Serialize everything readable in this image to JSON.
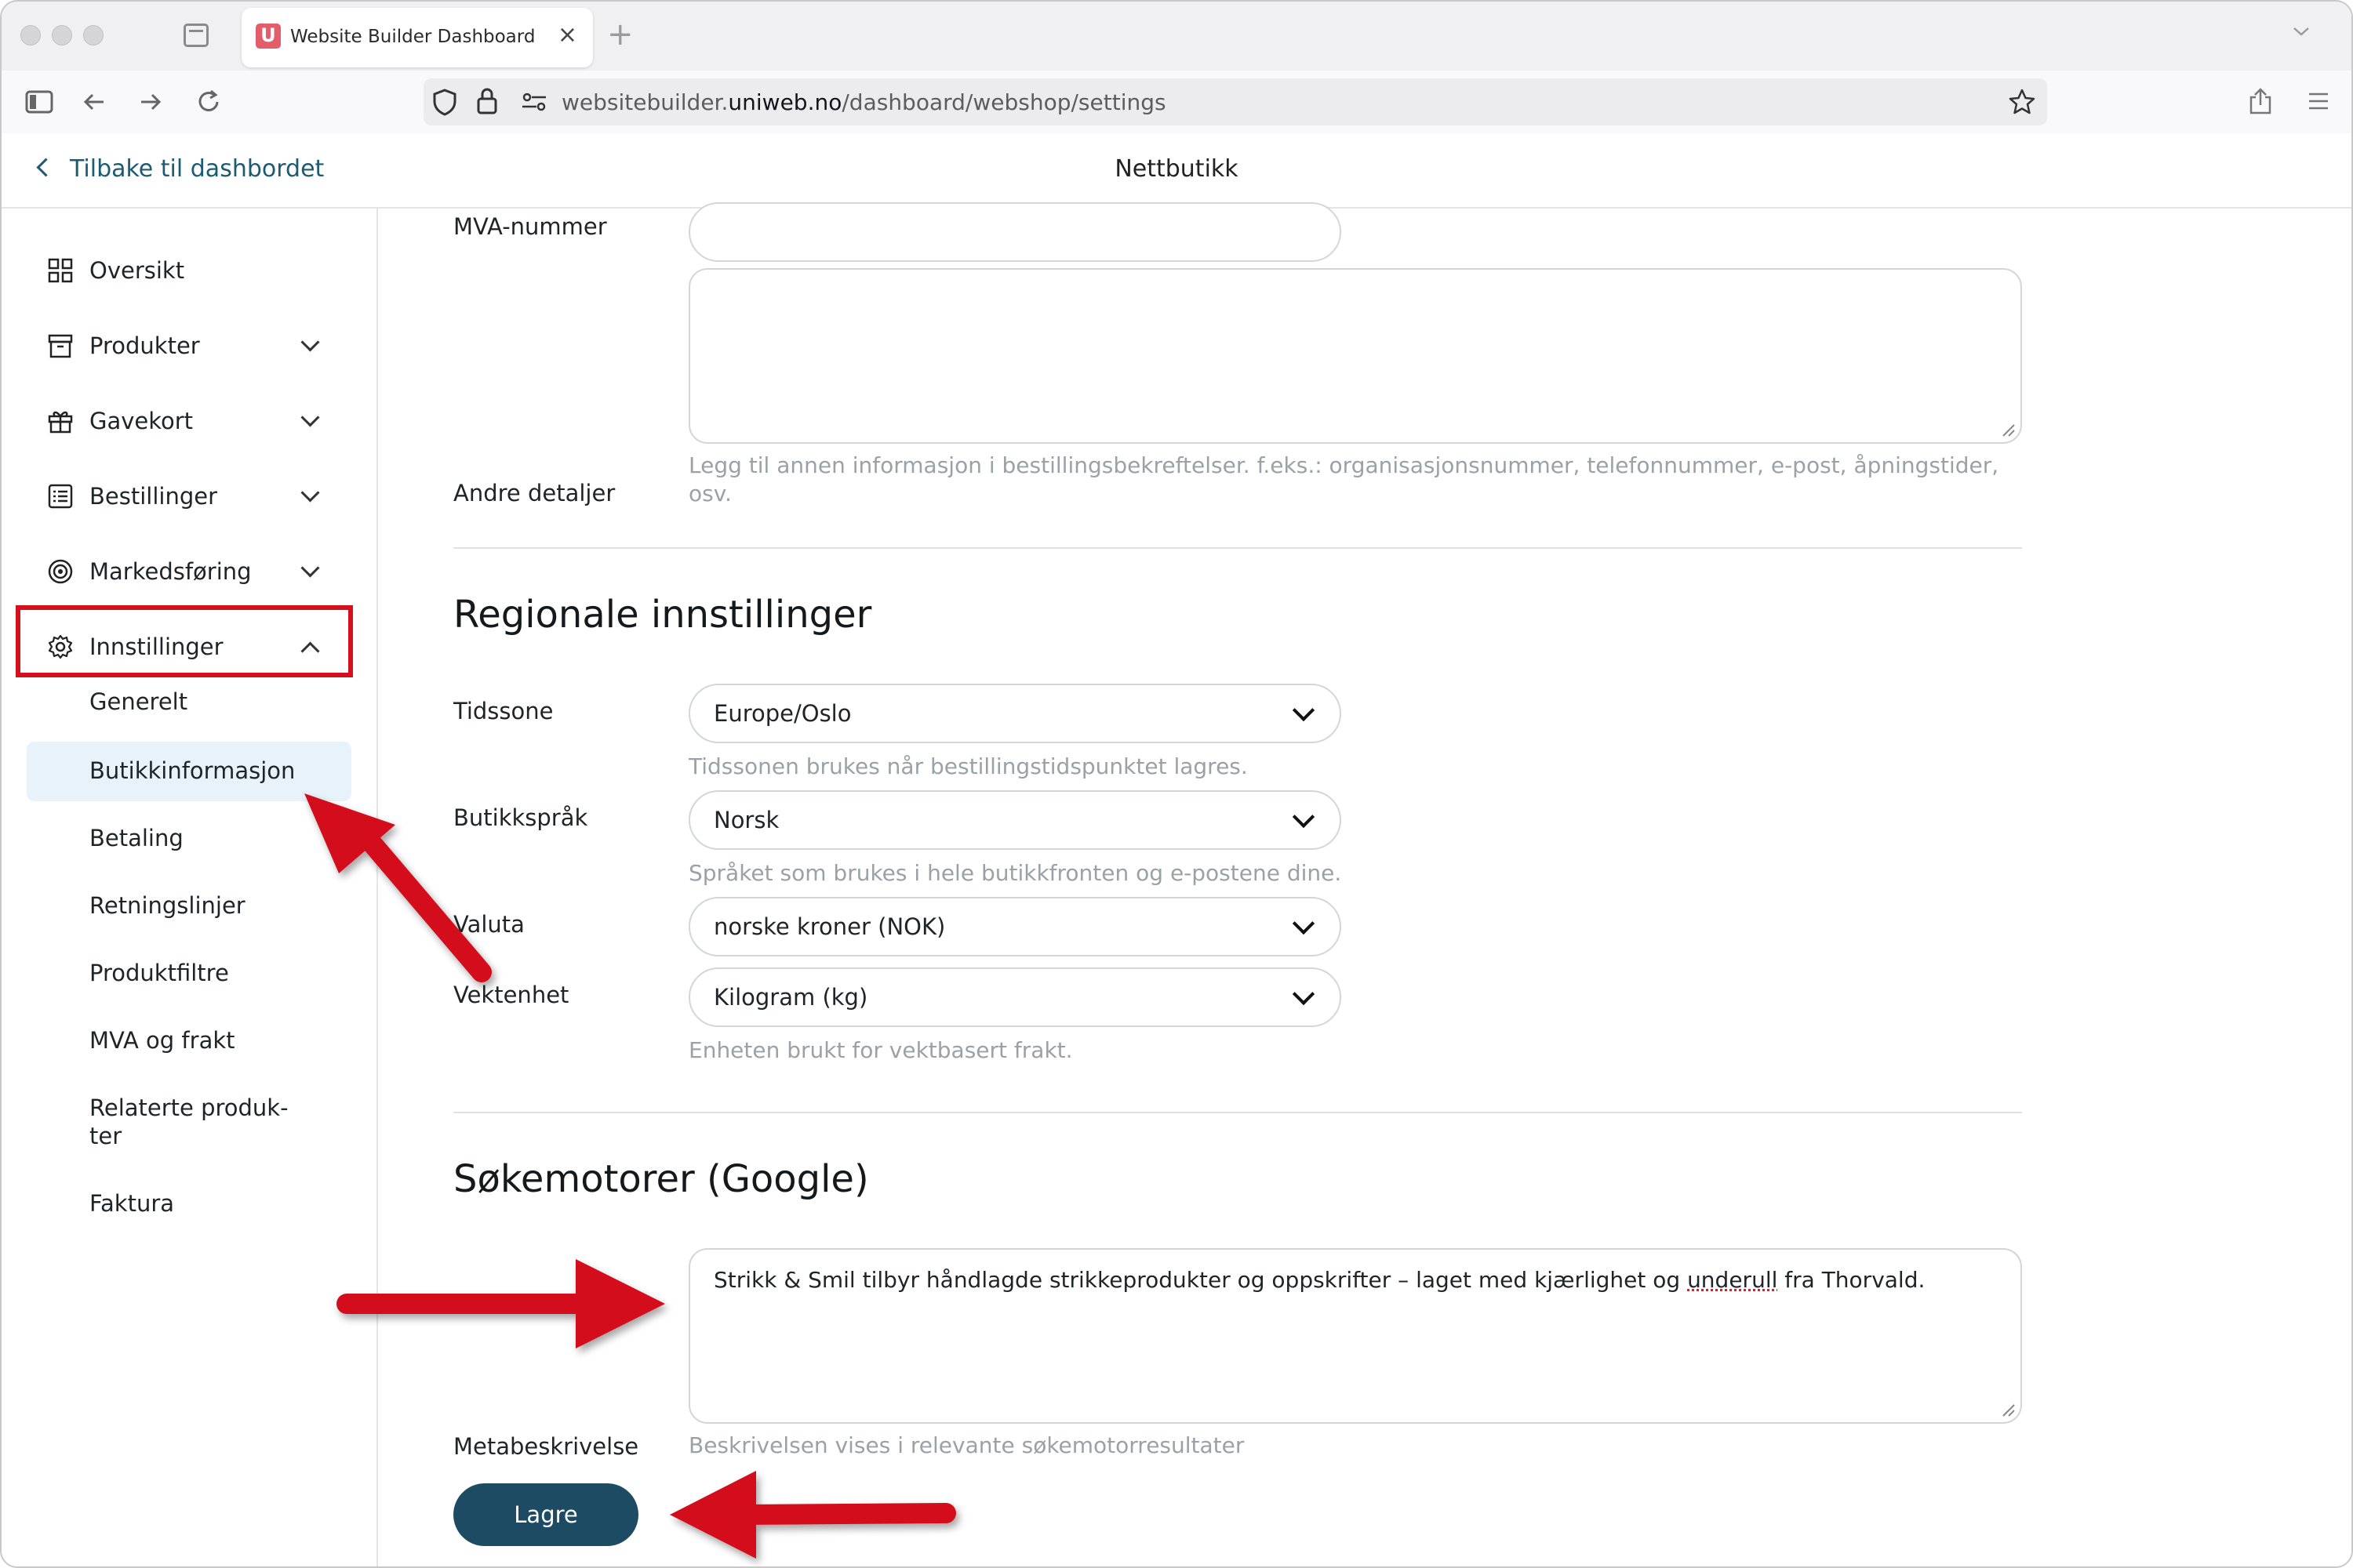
{
  "browser": {
    "tab_title": "Website Builder Dashboard",
    "tab_favicon": "U",
    "close_tab": "×",
    "new_tab": "+",
    "url_prefix": "websitebuilder.",
    "url_domain": "uniweb.no",
    "url_path": "/dashboard/webshop/settings"
  },
  "header": {
    "back_label": "Tilbake til dashbordet",
    "title": "Nettbutikk"
  },
  "sidebar": {
    "items": [
      {
        "label": "Oversikt",
        "icon": "grid-icon"
      },
      {
        "label": "Produkter",
        "icon": "archive-box-icon"
      },
      {
        "label": "Gavekort",
        "icon": "gift-icon"
      },
      {
        "label": "Bestillinger",
        "icon": "list-icon"
      },
      {
        "label": "Markedsføring",
        "icon": "target-icon"
      },
      {
        "label": "Innstillinger",
        "icon": "gear-icon"
      }
    ],
    "subitems": [
      "Generelt",
      "Butikkinformasjon",
      "Betaling",
      "Retningslinjer",
      "Produktfiltre",
      "MVA og frakt",
      "Relaterte produk-",
      "ter",
      "Faktura"
    ],
    "active_subitem": "Butikkinformasjon"
  },
  "form": {
    "vat_label": "MVA-nummer",
    "vat_value": "",
    "other_label": "Andre detaljer",
    "other_value": "",
    "other_help_line1": "Legg til annen informasjon i bestillingsbekreftelser. f.eks.: organisasjonsnummer, telefonnummer, e-post, åpningstider,",
    "other_help_line2": "osv.",
    "regional_heading": "Regionale innstillinger",
    "timezone_label": "Tidssone",
    "timezone_value": "Europe/Oslo",
    "timezone_help": "Tidssonen brukes når bestillingstidspunktet lagres.",
    "language_label": "Butikkspråk",
    "language_value": "Norsk",
    "language_help": "Språket som brukes i hele butikkfronten og e-postene dine.",
    "currency_label": "Valuta",
    "currency_value": "norske kroner (NOK)",
    "weight_label": "Vektenhet",
    "weight_value": "Kilogram (kg)",
    "weight_help": "Enheten brukt for vektbasert frakt.",
    "seo_heading": "Søkemotorer (Google)",
    "meta_label": "Metabeskrivelse",
    "meta_value_before": "Strikk & Smil tilbyr håndlagde strikkeprodukter og oppskrifter – laget med kjærlighet og ",
    "meta_value_misspelled": "underull",
    "meta_value_after": " fra Thorvald.",
    "meta_help": "Beskrivelsen vises i relevante søkemotorresultater",
    "save_label": "Lagre"
  },
  "colors": {
    "accent": "#1c4b63",
    "annotation_red": "#d4101e",
    "active_bg": "#e7f2fa"
  }
}
